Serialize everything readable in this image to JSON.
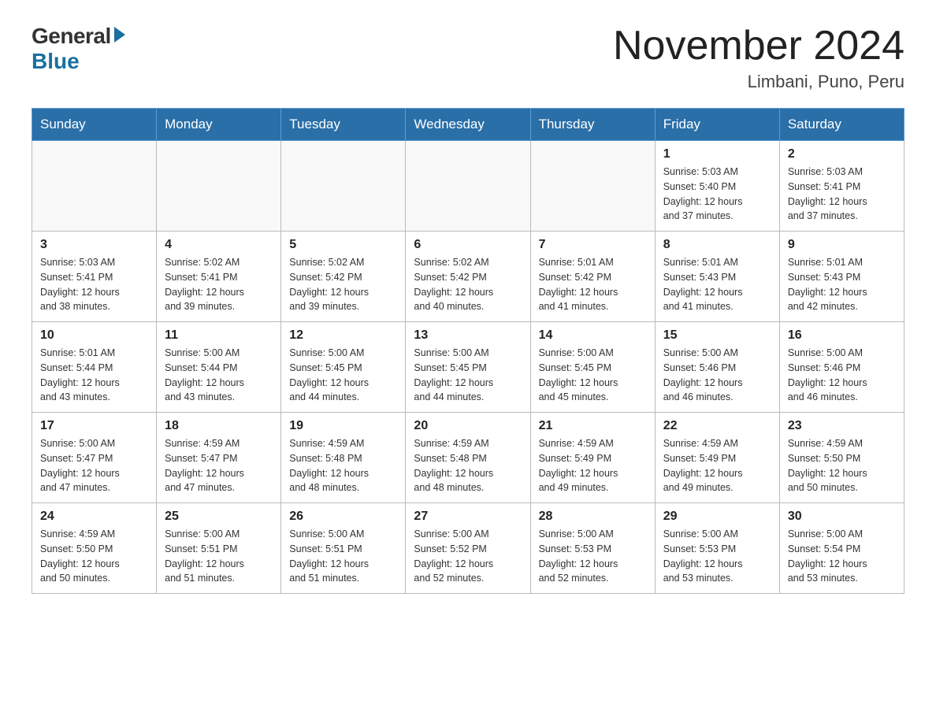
{
  "header": {
    "logo_general": "General",
    "logo_blue": "Blue",
    "month_title": "November 2024",
    "location": "Limbani, Puno, Peru"
  },
  "weekdays": [
    "Sunday",
    "Monday",
    "Tuesday",
    "Wednesday",
    "Thursday",
    "Friday",
    "Saturday"
  ],
  "weeks": [
    [
      {
        "day": "",
        "info": ""
      },
      {
        "day": "",
        "info": ""
      },
      {
        "day": "",
        "info": ""
      },
      {
        "day": "",
        "info": ""
      },
      {
        "day": "",
        "info": ""
      },
      {
        "day": "1",
        "info": "Sunrise: 5:03 AM\nSunset: 5:40 PM\nDaylight: 12 hours\nand 37 minutes."
      },
      {
        "day": "2",
        "info": "Sunrise: 5:03 AM\nSunset: 5:41 PM\nDaylight: 12 hours\nand 37 minutes."
      }
    ],
    [
      {
        "day": "3",
        "info": "Sunrise: 5:03 AM\nSunset: 5:41 PM\nDaylight: 12 hours\nand 38 minutes."
      },
      {
        "day": "4",
        "info": "Sunrise: 5:02 AM\nSunset: 5:41 PM\nDaylight: 12 hours\nand 39 minutes."
      },
      {
        "day": "5",
        "info": "Sunrise: 5:02 AM\nSunset: 5:42 PM\nDaylight: 12 hours\nand 39 minutes."
      },
      {
        "day": "6",
        "info": "Sunrise: 5:02 AM\nSunset: 5:42 PM\nDaylight: 12 hours\nand 40 minutes."
      },
      {
        "day": "7",
        "info": "Sunrise: 5:01 AM\nSunset: 5:42 PM\nDaylight: 12 hours\nand 41 minutes."
      },
      {
        "day": "8",
        "info": "Sunrise: 5:01 AM\nSunset: 5:43 PM\nDaylight: 12 hours\nand 41 minutes."
      },
      {
        "day": "9",
        "info": "Sunrise: 5:01 AM\nSunset: 5:43 PM\nDaylight: 12 hours\nand 42 minutes."
      }
    ],
    [
      {
        "day": "10",
        "info": "Sunrise: 5:01 AM\nSunset: 5:44 PM\nDaylight: 12 hours\nand 43 minutes."
      },
      {
        "day": "11",
        "info": "Sunrise: 5:00 AM\nSunset: 5:44 PM\nDaylight: 12 hours\nand 43 minutes."
      },
      {
        "day": "12",
        "info": "Sunrise: 5:00 AM\nSunset: 5:45 PM\nDaylight: 12 hours\nand 44 minutes."
      },
      {
        "day": "13",
        "info": "Sunrise: 5:00 AM\nSunset: 5:45 PM\nDaylight: 12 hours\nand 44 minutes."
      },
      {
        "day": "14",
        "info": "Sunrise: 5:00 AM\nSunset: 5:45 PM\nDaylight: 12 hours\nand 45 minutes."
      },
      {
        "day": "15",
        "info": "Sunrise: 5:00 AM\nSunset: 5:46 PM\nDaylight: 12 hours\nand 46 minutes."
      },
      {
        "day": "16",
        "info": "Sunrise: 5:00 AM\nSunset: 5:46 PM\nDaylight: 12 hours\nand 46 minutes."
      }
    ],
    [
      {
        "day": "17",
        "info": "Sunrise: 5:00 AM\nSunset: 5:47 PM\nDaylight: 12 hours\nand 47 minutes."
      },
      {
        "day": "18",
        "info": "Sunrise: 4:59 AM\nSunset: 5:47 PM\nDaylight: 12 hours\nand 47 minutes."
      },
      {
        "day": "19",
        "info": "Sunrise: 4:59 AM\nSunset: 5:48 PM\nDaylight: 12 hours\nand 48 minutes."
      },
      {
        "day": "20",
        "info": "Sunrise: 4:59 AM\nSunset: 5:48 PM\nDaylight: 12 hours\nand 48 minutes."
      },
      {
        "day": "21",
        "info": "Sunrise: 4:59 AM\nSunset: 5:49 PM\nDaylight: 12 hours\nand 49 minutes."
      },
      {
        "day": "22",
        "info": "Sunrise: 4:59 AM\nSunset: 5:49 PM\nDaylight: 12 hours\nand 49 minutes."
      },
      {
        "day": "23",
        "info": "Sunrise: 4:59 AM\nSunset: 5:50 PM\nDaylight: 12 hours\nand 50 minutes."
      }
    ],
    [
      {
        "day": "24",
        "info": "Sunrise: 4:59 AM\nSunset: 5:50 PM\nDaylight: 12 hours\nand 50 minutes."
      },
      {
        "day": "25",
        "info": "Sunrise: 5:00 AM\nSunset: 5:51 PM\nDaylight: 12 hours\nand 51 minutes."
      },
      {
        "day": "26",
        "info": "Sunrise: 5:00 AM\nSunset: 5:51 PM\nDaylight: 12 hours\nand 51 minutes."
      },
      {
        "day": "27",
        "info": "Sunrise: 5:00 AM\nSunset: 5:52 PM\nDaylight: 12 hours\nand 52 minutes."
      },
      {
        "day": "28",
        "info": "Sunrise: 5:00 AM\nSunset: 5:53 PM\nDaylight: 12 hours\nand 52 minutes."
      },
      {
        "day": "29",
        "info": "Sunrise: 5:00 AM\nSunset: 5:53 PM\nDaylight: 12 hours\nand 53 minutes."
      },
      {
        "day": "30",
        "info": "Sunrise: 5:00 AM\nSunset: 5:54 PM\nDaylight: 12 hours\nand 53 minutes."
      }
    ]
  ]
}
